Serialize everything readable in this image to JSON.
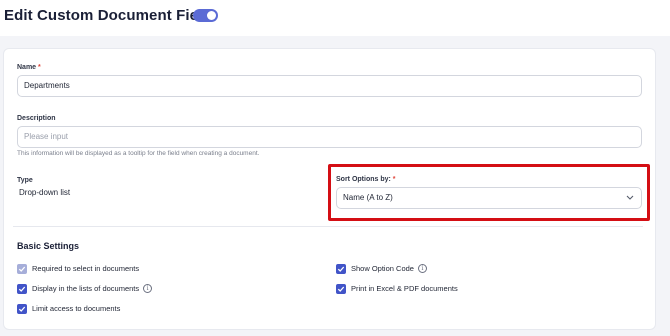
{
  "header": {
    "title": "Edit Custom Document Field",
    "toggle_on": true
  },
  "form": {
    "name": {
      "label": "Name",
      "required_mark": "*",
      "value": "Departments"
    },
    "description": {
      "label": "Description",
      "placeholder": "Please input",
      "hint": "This information will be displayed as a tooltip for the field when creating a document."
    },
    "type": {
      "label": "Type",
      "value": "Drop-down list"
    },
    "sort": {
      "label": "Sort Options by:",
      "required_mark": "*",
      "value": "Name (A to Z)"
    }
  },
  "basic_settings": {
    "title": "Basic Settings",
    "options": [
      {
        "label": "Required to select in documents",
        "checked": true,
        "disabled": true,
        "info": false
      },
      {
        "label": "Display in the lists of documents",
        "checked": true,
        "disabled": false,
        "info": true
      },
      {
        "label": "Limit access to documents",
        "checked": true,
        "disabled": false,
        "info": false
      },
      {
        "label": "Show Option Code",
        "checked": true,
        "disabled": false,
        "info": true
      },
      {
        "label": "Print in Excel & PDF documents",
        "checked": true,
        "disabled": false,
        "info": false
      }
    ]
  },
  "colors": {
    "accent": "#4154c8",
    "highlight": "#d40e14",
    "required": "#e0453a"
  },
  "icons": {
    "info": "info-icon",
    "dropdown": "chevron-down-icon",
    "check": "check-icon"
  }
}
